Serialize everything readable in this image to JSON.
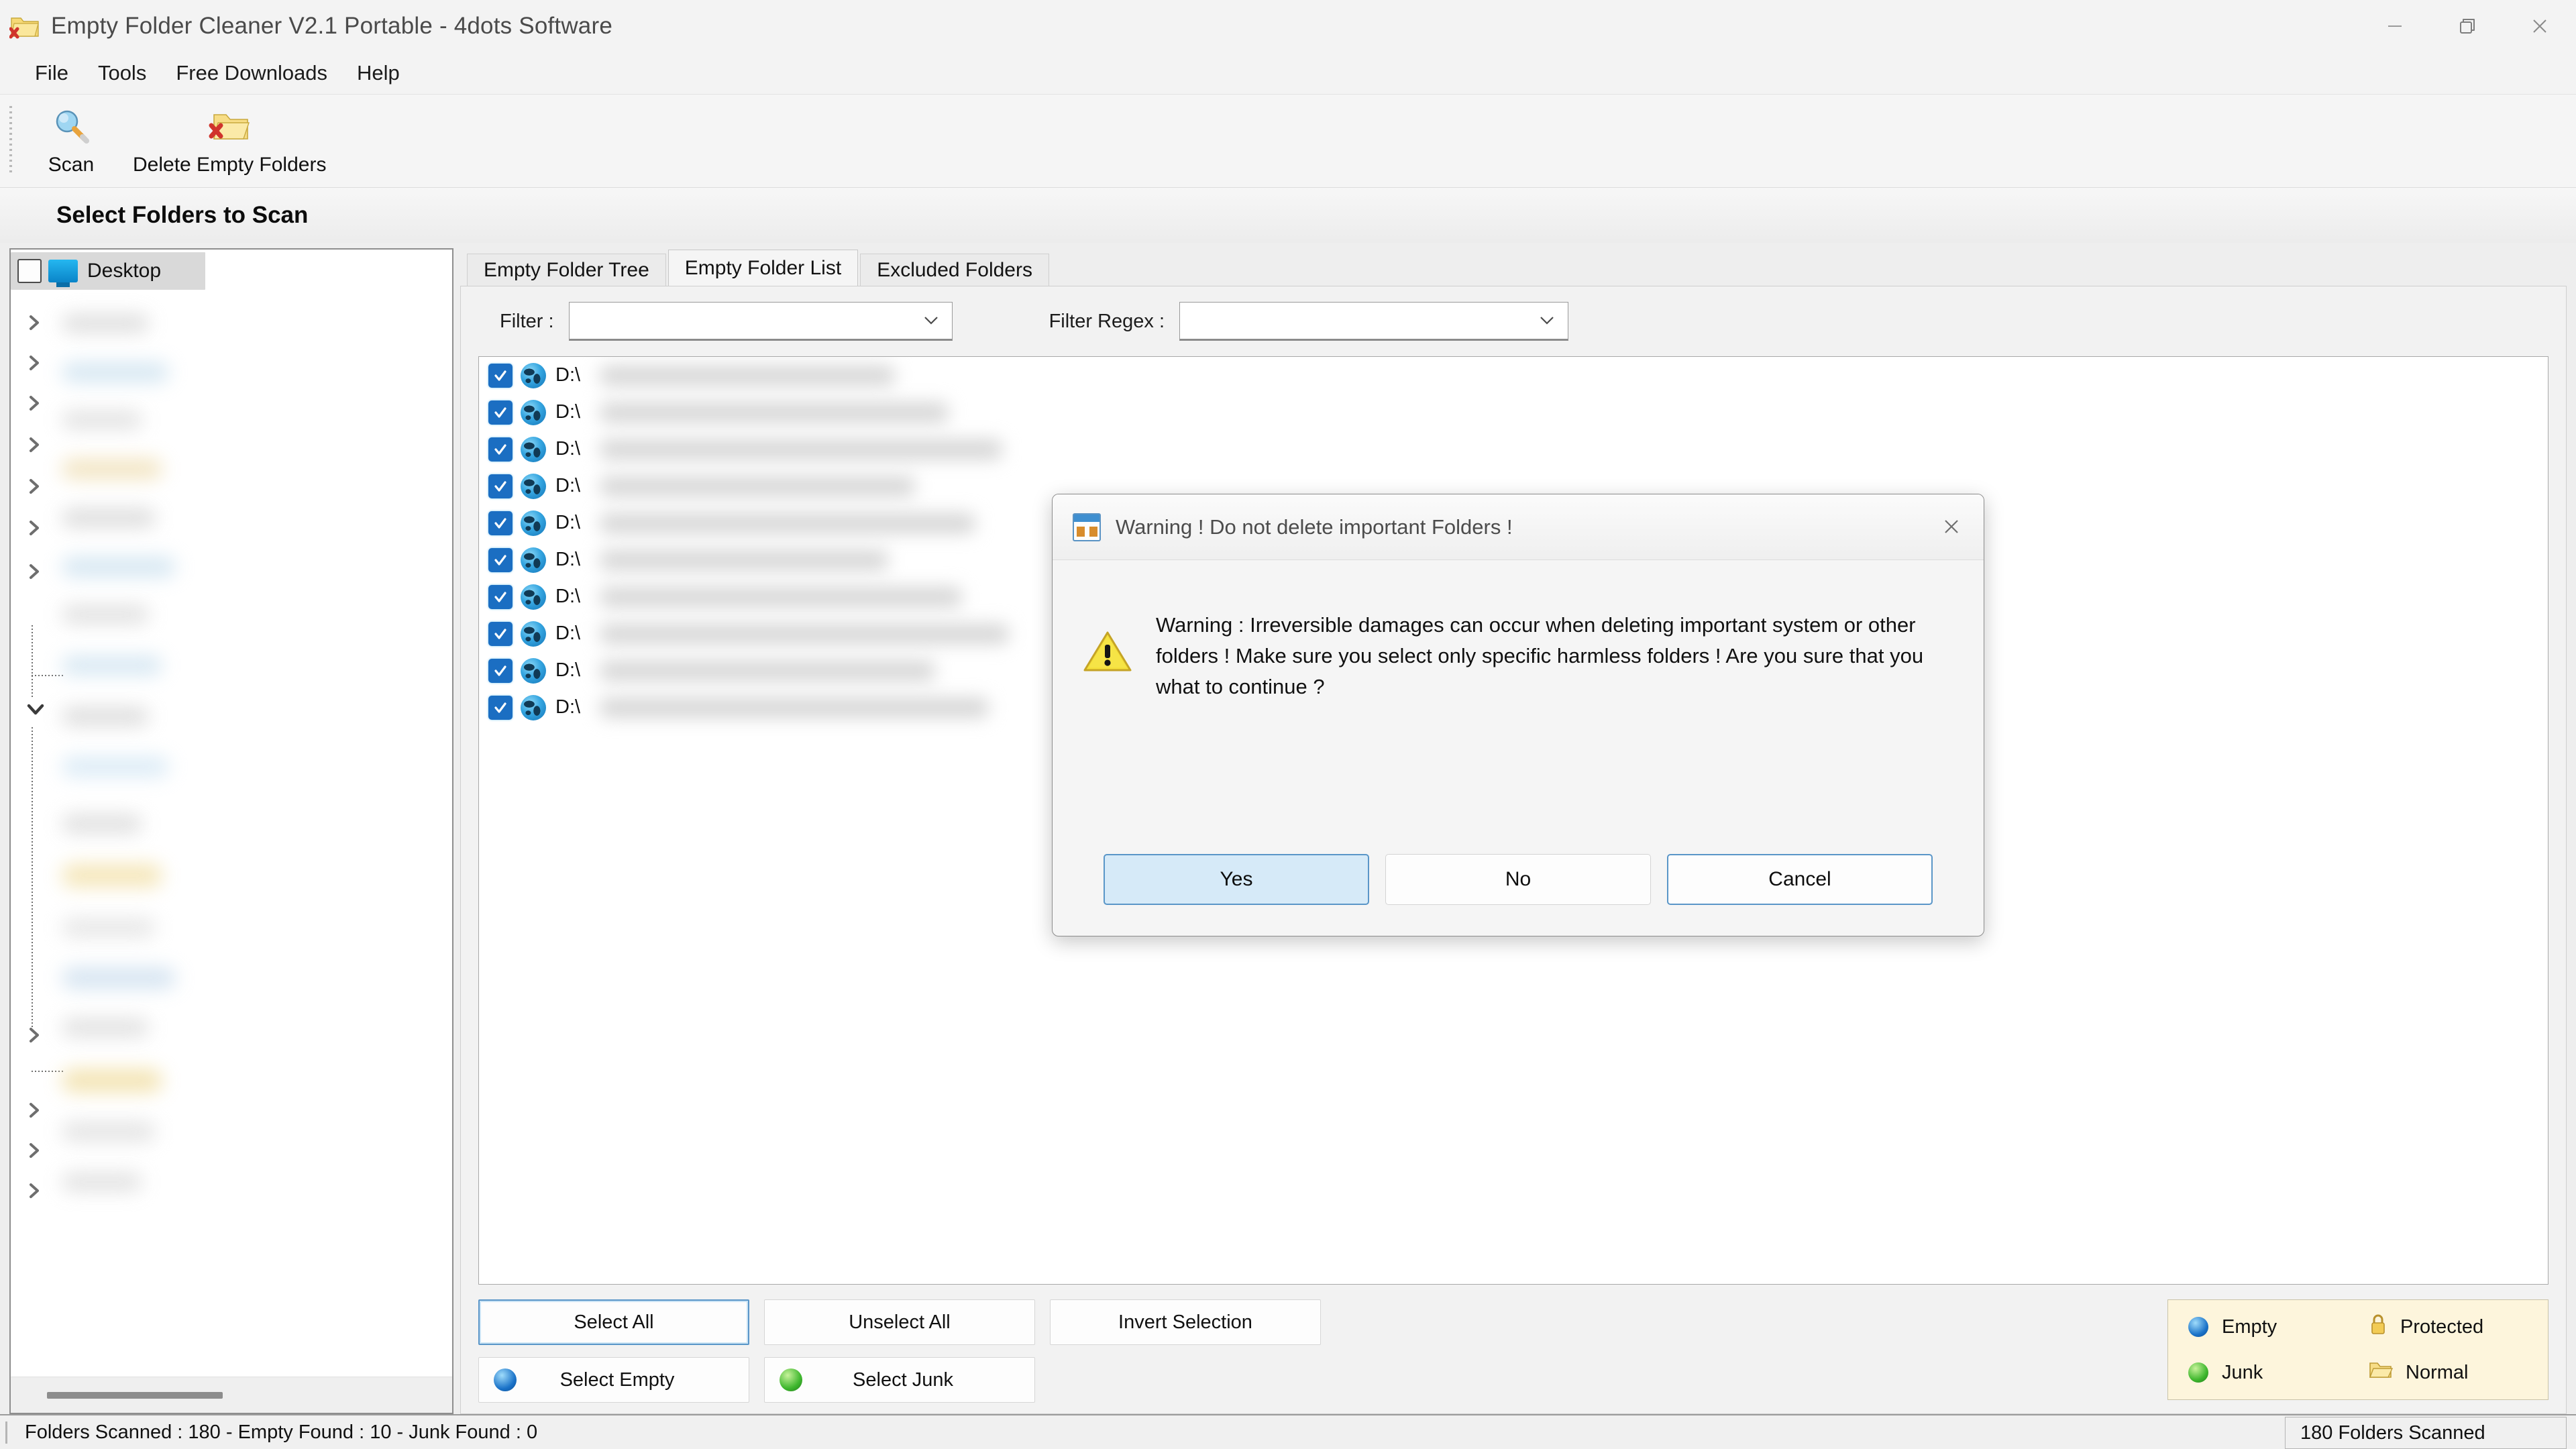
{
  "window": {
    "title": "Empty Folder Cleaner V2.1 Portable - 4dots Software",
    "icon": "folder-delete-icon",
    "controls": {
      "minimize": "minimize-icon",
      "restore": "restore-icon",
      "close": "close-icon"
    }
  },
  "menubar": {
    "items": [
      {
        "label": "File"
      },
      {
        "label": "Tools"
      },
      {
        "label": "Free Downloads"
      },
      {
        "label": "Help"
      }
    ]
  },
  "toolbar": {
    "buttons": [
      {
        "label": "Scan",
        "icon": "magnifier-icon"
      },
      {
        "label": "Delete Empty Folders",
        "icon": "folder-delete-icon"
      }
    ]
  },
  "section": {
    "header": "Select Folders to Scan"
  },
  "tree": {
    "root": {
      "label": "Desktop",
      "icon": "monitor-icon",
      "checked": false,
      "selected": true
    },
    "redacted_children_count": 14
  },
  "tabs": [
    {
      "label": "Empty Folder Tree",
      "active": false
    },
    {
      "label": "Empty Folder List",
      "active": true
    },
    {
      "label": "Excluded Folders",
      "active": false
    }
  ],
  "filters": {
    "filter_label": "Filter :",
    "filter_value": "",
    "regex_label": "Filter Regex :",
    "regex_value": ""
  },
  "folder_list": {
    "rows": [
      {
        "checked": true,
        "icon": "globe-icon",
        "path": "D:\\"
      },
      {
        "checked": true,
        "icon": "globe-icon",
        "path": "D:\\"
      },
      {
        "checked": true,
        "icon": "globe-icon",
        "path": "D:\\"
      },
      {
        "checked": true,
        "icon": "globe-icon",
        "path": "D:\\"
      },
      {
        "checked": true,
        "icon": "globe-icon",
        "path": "D:\\"
      },
      {
        "checked": true,
        "icon": "globe-icon",
        "path": "D:\\"
      },
      {
        "checked": true,
        "icon": "globe-icon",
        "path": "D:\\"
      },
      {
        "checked": true,
        "icon": "globe-icon",
        "path": "D:\\"
      },
      {
        "checked": true,
        "icon": "globe-icon",
        "path": "D:\\"
      },
      {
        "checked": true,
        "icon": "globe-icon",
        "path": "D:\\"
      }
    ]
  },
  "selection_buttons": {
    "select_all": "Select All",
    "unselect_all": "Unselect All",
    "invert_selection": "Invert Selection",
    "select_empty": "Select Empty",
    "select_junk": "Select Junk"
  },
  "legend": {
    "empty": "Empty",
    "protected": "Protected",
    "junk": "Junk",
    "normal": "Normal",
    "colors": {
      "empty": "#1a72c8",
      "junk": "#3fb72e",
      "protected": "#e8b92c",
      "normal": "#f0cf62"
    }
  },
  "statusbar": {
    "left": "Folders Scanned : 180 - Empty Found : 10 - Junk Found : 0",
    "right": "180 Folders Scanned"
  },
  "dialog": {
    "title": "Warning ! Do not delete important Folders !",
    "icon": "app-warning-icon",
    "close_icon": "close-icon",
    "warn_icon": "warning-triangle-icon",
    "message": "Warning : Irreversible damages can occur when deleting important system or other folders ! Make sure you select only specific harmless folders ! Are you sure that you what to continue ?",
    "buttons": {
      "yes": "Yes",
      "no": "No",
      "cancel": "Cancel"
    }
  }
}
